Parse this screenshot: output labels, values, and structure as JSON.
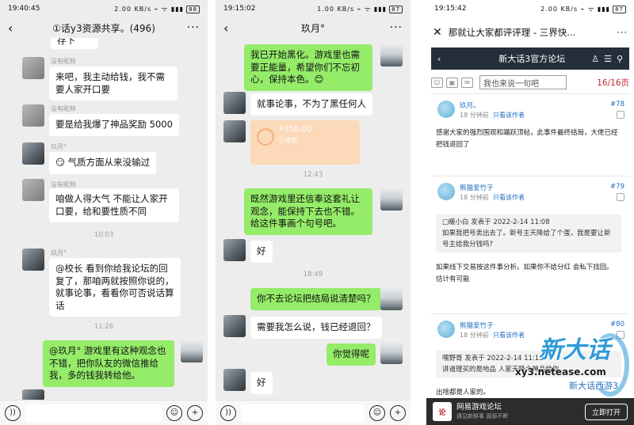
{
  "screen1": {
    "status": {
      "time": "19:40:45",
      "icons": "2.00 KB/s ⌁ ᯤ ▮▮▮",
      "battery": "88"
    },
    "header": {
      "title": "①话y3资源共享。(496)"
    },
    "top_fragment": "存下",
    "messages": [
      {
        "nick": "没有昵称",
        "text": "来吧，我主动给钱，我不需要人家开口要"
      },
      {
        "nick": "没有昵称",
        "text": "要是给我爆了神品奖励 5000"
      },
      {
        "nick": "玖月°",
        "text": "😏 气质方面从来没输过"
      },
      {
        "nick": "没有昵称",
        "text": "咱做人得大气 不能让人家开口要，给和要性质不同"
      },
      {
        "time": "10:03"
      },
      {
        "nick": "玖月°",
        "text": "@校长  看到你给我论坛的回复了，那咱两就按照你说的，就事论事，看看你可否说话算话"
      },
      {
        "time": "11:26"
      },
      {
        "text": "@玖月° 游戏里有这种观念也不错，把你队友的微信推给我，多的钱我转给他。"
      }
    ]
  },
  "screen2": {
    "status": {
      "time": "19:15:02",
      "icons": "1.00 KB/s ⌁ ᯤ ▮▮▮",
      "battery": "87"
    },
    "header": {
      "title": "玖月°"
    },
    "messages": [
      {
        "text": "我已开始黑化。游戏里也需要正能量，希望你们不忘初心，保持本色。😊"
      },
      {
        "text": "就事论事，不为了黑任何人"
      },
      {
        "amount": "¥350.00",
        "status": "已收款"
      },
      {
        "time": "12:43"
      },
      {
        "text": "既然游戏里还信奉这套礼让观念，能保持下去也不错。给这件事画个句号吧。"
      },
      {
        "text": "好"
      },
      {
        "time": "18:49"
      },
      {
        "text": "你不去论坛把结局说清楚吗？"
      },
      {
        "text": "需要我怎么说，钱已经退回？"
      },
      {
        "text": "你觉得呢"
      },
      {
        "text": "好"
      }
    ]
  },
  "screen3": {
    "status": {
      "time": "19:15:42",
      "icons": "2.00 KB/s ⌁ ᯤ ▮▮▮",
      "battery": "87"
    },
    "header": {
      "title": "那就让大家都评评理 - 三界快..."
    },
    "forum_bar": {
      "title": "新大话3官方论坛"
    },
    "toolbar": {
      "reply_placeholder": "我也来说一句吧",
      "page": "16/16页"
    },
    "posts": [
      {
        "name": "玖月。",
        "time": "18 分钟前",
        "only": "只看该作者",
        "no": "#78",
        "text": "感谢大家的强烈围观和踊跃顶帖，此事件最终结局，大佬已经把钱退回了"
      },
      {
        "name": "熊猫爱竹子",
        "time": "18 分钟前",
        "only": "只看该作者",
        "no": "#79",
        "quote": "□暖小白 发表于 2022-2-14 11:08\n如果我把号卖出去了。新号主天降给了个蛋，我是要让新号主给我分钱吗?",
        "text": "如果线下交易按这件事分析。如果你不给分红 会私下找回。 估计有可能"
      },
      {
        "name": "熊猫爱竹子",
        "time": "18 分钟前",
        "only": "只看该作者",
        "no": "#80",
        "quote": "嘿野哥 发表于 2022-2-14 11:15\n讲道理买的是地品 人家天降个神品给你",
        "text": "出啥都是人家的。"
      }
    ],
    "banner": {
      "title": "网易游戏论坛",
      "subtitle": "遇见新鲜事 源源不断",
      "open": "立即打开"
    },
    "watermark": {
      "logo": "新大话",
      "url": "xy3.netease.com",
      "cn": "新大话西游3"
    }
  }
}
